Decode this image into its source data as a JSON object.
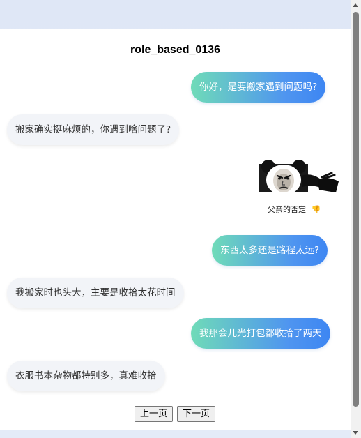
{
  "title": "role_based_0136",
  "messages": [
    {
      "role": "user",
      "text": "你好，是要搬家遇到问题吗?"
    },
    {
      "role": "bot",
      "text": "搬家确实挺麻烦的，你遇到啥问题了?"
    },
    {
      "role": "user-sticker",
      "caption": "父亲的否定",
      "emoji": "👎"
    },
    {
      "role": "user",
      "text": "东西太多还是路程太远?"
    },
    {
      "role": "bot",
      "text": "我搬家时也头大，主要是收拾太花时间"
    },
    {
      "role": "user",
      "text": "我那会儿光打包都收拾了两天"
    },
    {
      "role": "bot",
      "text": "衣服书本杂物都特别多，真难收拾"
    }
  ],
  "pagination": {
    "prev_label": "上一页",
    "next_label": "下一页"
  },
  "colors": {
    "user_bubble_start": "#6fdbb8",
    "user_bubble_end": "#3d86f2",
    "bot_bubble": "#f2f4f8",
    "background": "#dfe7f6"
  }
}
